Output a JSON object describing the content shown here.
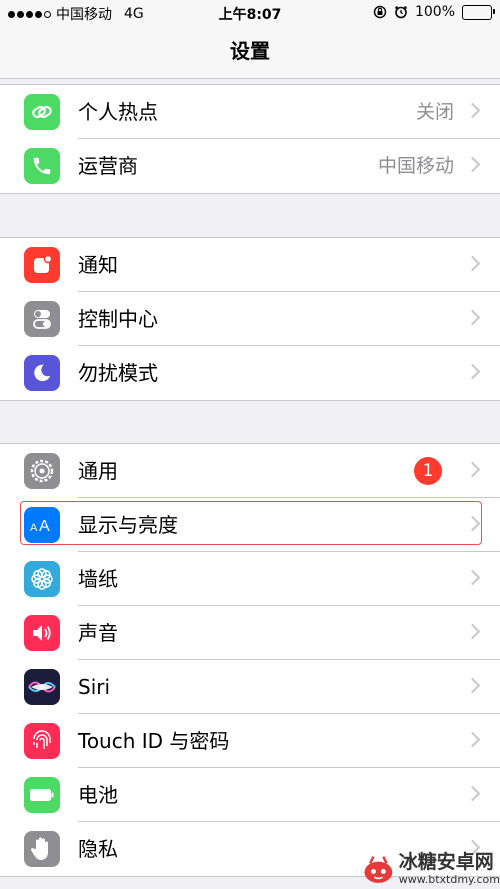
{
  "status_bar": {
    "carrier": "中国移动",
    "network": "4G",
    "time": "上午8:07",
    "battery": "100%",
    "battery_level": 1.0
  },
  "nav": {
    "title": "设置"
  },
  "groups": [
    [
      {
        "key": "hotspot",
        "label": "个人热点",
        "detail": "关闭",
        "icon": "hotspot-icon",
        "color": "#4cd964"
      },
      {
        "key": "carrier",
        "label": "运营商",
        "detail": "中国移动",
        "icon": "phone-icon",
        "color": "#4cd964"
      }
    ],
    [
      {
        "key": "notifications",
        "label": "通知",
        "icon": "notifications-icon",
        "color": "#ff3b30"
      },
      {
        "key": "control-center",
        "label": "控制中心",
        "icon": "control-center-icon",
        "color": "#8e8e93"
      },
      {
        "key": "do-not-disturb",
        "label": "勿扰模式",
        "icon": "moon-icon",
        "color": "#5856d6"
      }
    ],
    [
      {
        "key": "general",
        "label": "通用",
        "badge": "1",
        "icon": "gear-icon",
        "color": "#8e8e93"
      },
      {
        "key": "display-brightness",
        "label": "显示与亮度",
        "icon": "display-aa-icon",
        "color": "#007aff",
        "highlighted": true
      },
      {
        "key": "wallpaper",
        "label": "墙纸",
        "icon": "wallpaper-flower-icon",
        "color": "#34aadc"
      },
      {
        "key": "sounds",
        "label": "声音",
        "icon": "speaker-icon",
        "color": "#ff2d55"
      },
      {
        "key": "siri",
        "label": "Siri",
        "icon": "siri-icon",
        "color": "#1c1c3c"
      },
      {
        "key": "touch-id",
        "label": "Touch ID 与密码",
        "icon": "fingerprint-icon",
        "color": "#ff2d55"
      },
      {
        "key": "battery",
        "label": "电池",
        "icon": "battery-icon",
        "color": "#4cd964"
      },
      {
        "key": "privacy",
        "label": "隐私",
        "icon": "hand-icon",
        "color": "#8e8e93"
      }
    ]
  ],
  "watermark": {
    "name": "冰糖安卓网",
    "url": "www.btxtdmy.com"
  }
}
